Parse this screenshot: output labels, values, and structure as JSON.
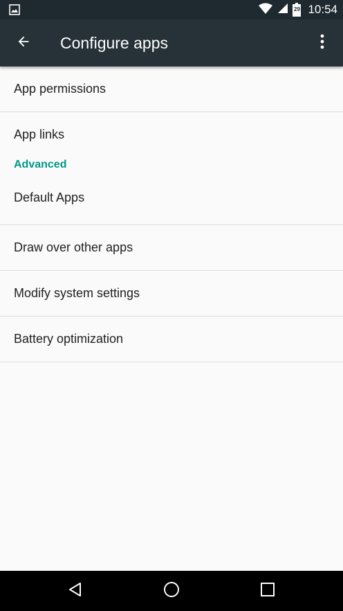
{
  "status_bar": {
    "time": "10:54",
    "battery_level": "29",
    "icons": [
      "image-notification-icon",
      "wifi-icon",
      "cell-signal-icon",
      "battery-icon"
    ]
  },
  "app_bar": {
    "title": "Configure apps",
    "back_icon": "arrow-back-icon",
    "menu_icon": "more-vert-icon",
    "background": "#263238"
  },
  "list": {
    "items_top": [
      {
        "label": "App permissions"
      },
      {
        "label": "App links"
      }
    ],
    "section_header": "Advanced",
    "section_color": "#009688",
    "items_advanced": [
      {
        "label": "Default Apps"
      },
      {
        "label": "Draw over other apps"
      },
      {
        "label": "Modify system settings"
      },
      {
        "label": "Battery optimization"
      }
    ]
  },
  "nav_bar": {
    "icons": [
      "back-triangle-icon",
      "home-circle-icon",
      "recents-square-icon"
    ]
  }
}
